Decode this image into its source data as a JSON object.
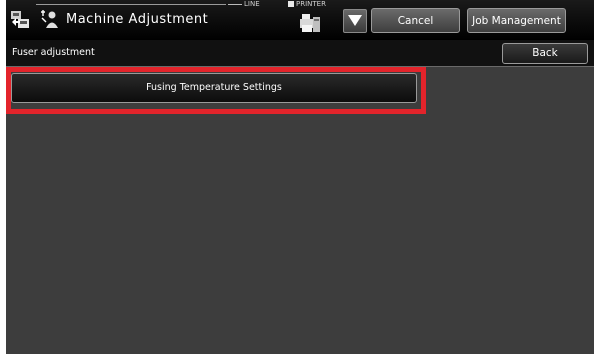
{
  "header": {
    "title": "Machine Adjustment",
    "line_status": "LINE",
    "printer_label": "PRINTER",
    "cancel_label": "Cancel",
    "job_management_label": "Job Management",
    "icons": {
      "app": "machine-adjustment-icon",
      "mode": "user-setting-icon",
      "printer": "printer-icon",
      "dropdown": "triangle-down-icon"
    }
  },
  "subheader": {
    "title": "Fuser adjustment",
    "back_label": "Back"
  },
  "menu": {
    "items": [
      {
        "label": "Fusing Temperature Settings"
      }
    ]
  },
  "colors": {
    "background": "#3d3d3d",
    "header": "#000000",
    "highlight": "#e3242b"
  }
}
